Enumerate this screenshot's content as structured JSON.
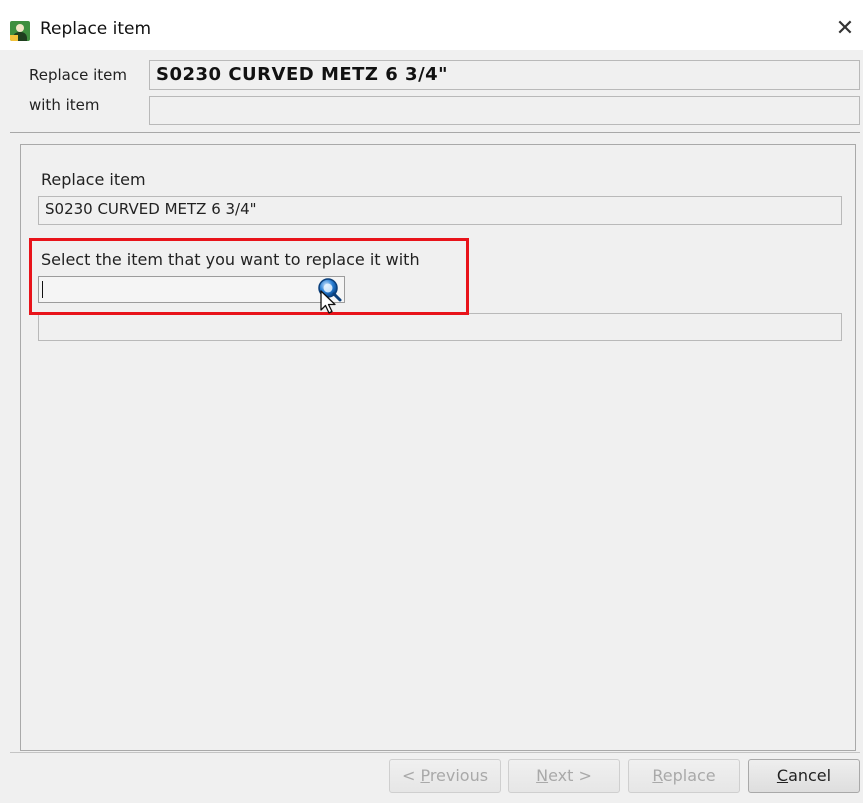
{
  "window": {
    "title": "Replace item",
    "close_glyph": "✕"
  },
  "header": {
    "replace_item_label": "Replace item",
    "replace_item_value": "S0230 CURVED METZ 6 3/4\"",
    "with_item_label": "with item",
    "with_item_value": ""
  },
  "main": {
    "replace_item_label": "Replace item",
    "replace_item_value": "S0230 CURVED METZ 6 3/4\"",
    "select_prompt": "Select the item that you want to replace it with",
    "select_input_value": "",
    "selected_item_description": ""
  },
  "footer": {
    "previous": {
      "prefix": "< ",
      "mnemonic": "P",
      "rest": "revious"
    },
    "next": {
      "mnemonic": "N",
      "rest": "ext >"
    },
    "replace": {
      "mnemonic": "R",
      "rest": "eplace"
    },
    "cancel": {
      "mnemonic": "C",
      "rest": "ancel"
    }
  },
  "icons": {
    "app": "user-icon",
    "close": "close-icon",
    "search": "search-icon",
    "cursor": "mouse-pointer-icon"
  },
  "colors": {
    "highlight": "#e8131a",
    "window_bg": "#f0f0f0",
    "app_icon_green": "#3f8f3f",
    "search_icon_blue": "#2a7fd4"
  }
}
